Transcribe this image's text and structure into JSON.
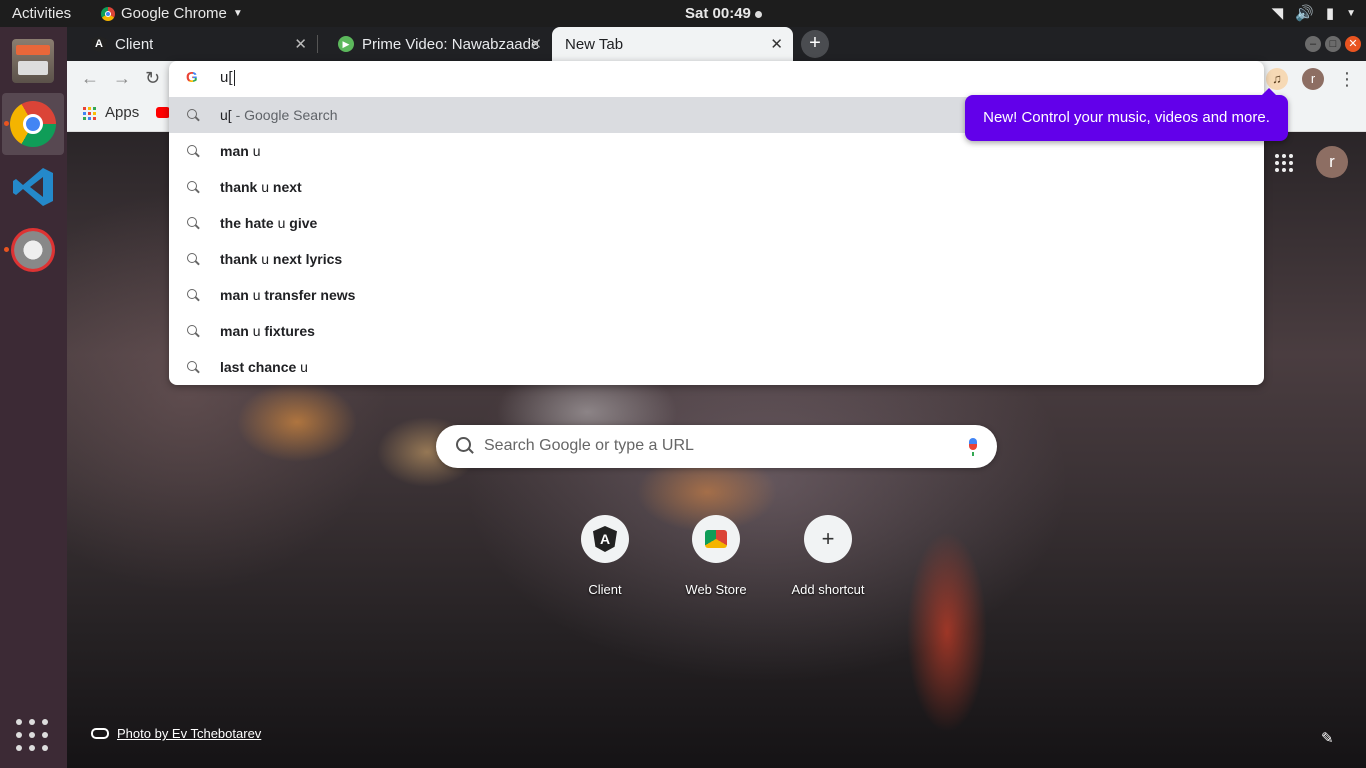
{
  "topbar": {
    "activities": "Activities",
    "app_name": "Google Chrome",
    "clock": "Sat 00:49"
  },
  "tabs": [
    {
      "title": "Client",
      "favicon": "angular-icon",
      "active": false
    },
    {
      "title": "Prime Video: Nawabzaade",
      "favicon": "prime-video-icon",
      "active": false
    },
    {
      "title": "New Tab",
      "favicon": "",
      "active": true
    }
  ],
  "bookmarks": {
    "apps_label": "Apps"
  },
  "omnibox": {
    "input_value": "u[",
    "suggestions": [
      {
        "typed": "u[",
        "rest": "",
        "suffix": " - Google Search",
        "selected": true
      },
      {
        "pre": "man ",
        "typed": "u",
        "post": ""
      },
      {
        "pre": "thank ",
        "typed": "u",
        "post": " next"
      },
      {
        "pre": "the hate ",
        "typed": "u",
        "post": " give"
      },
      {
        "pre": "thank ",
        "typed": "u",
        "post": " next lyrics"
      },
      {
        "pre": "man ",
        "typed": "u",
        "post": " transfer news"
      },
      {
        "pre": "man ",
        "typed": "u",
        "post": " fixtures"
      },
      {
        "pre": "last chance ",
        "typed": "u",
        "post": ""
      }
    ]
  },
  "promo": {
    "text": "New! Control your music, videos and more."
  },
  "ntp": {
    "search_placeholder": "Search Google or type a URL",
    "avatar_letter": "r",
    "shortcuts": [
      {
        "label": "Client",
        "icon": "angular-icon"
      },
      {
        "label": "Web Store",
        "icon": "web-store-icon"
      },
      {
        "label": "Add shortcut",
        "icon": "plus-icon"
      }
    ],
    "attribution": "Photo by Ev Tchebotarev"
  },
  "toolbar": {
    "avatar_letter": "r"
  },
  "colors": {
    "promo_bg": "#6200ea",
    "accent_orange": "#e95420",
    "dock_bg": "#3c2a35"
  }
}
